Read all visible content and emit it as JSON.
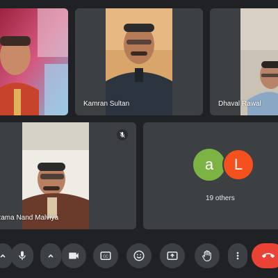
{
  "participants": [
    {
      "id": "p1",
      "name": ""
    },
    {
      "id": "p2",
      "name": "Kamran Sultan"
    },
    {
      "id": "p3",
      "name": "Dhaval Rawal"
    },
    {
      "id": "p4",
      "name": "Rama Nand Malviya",
      "muted": true
    }
  ],
  "others": {
    "avatars": [
      {
        "letter": "a",
        "color": "#7cb342"
      },
      {
        "letter": "L",
        "color": "#f4511e"
      }
    ],
    "label": "19 others"
  },
  "controls": {
    "mic": "mic-icon",
    "camera": "videocam-icon",
    "captions": "closed-captions-icon",
    "reactions": "emoji-icon",
    "present": "present-screen-icon",
    "raise_hand": "raise-hand-icon",
    "more": "more-vert-icon",
    "end_call": "call-end-icon"
  },
  "colors": {
    "background": "#202124",
    "tile": "#3c4043",
    "end_call": "#ea4335"
  }
}
